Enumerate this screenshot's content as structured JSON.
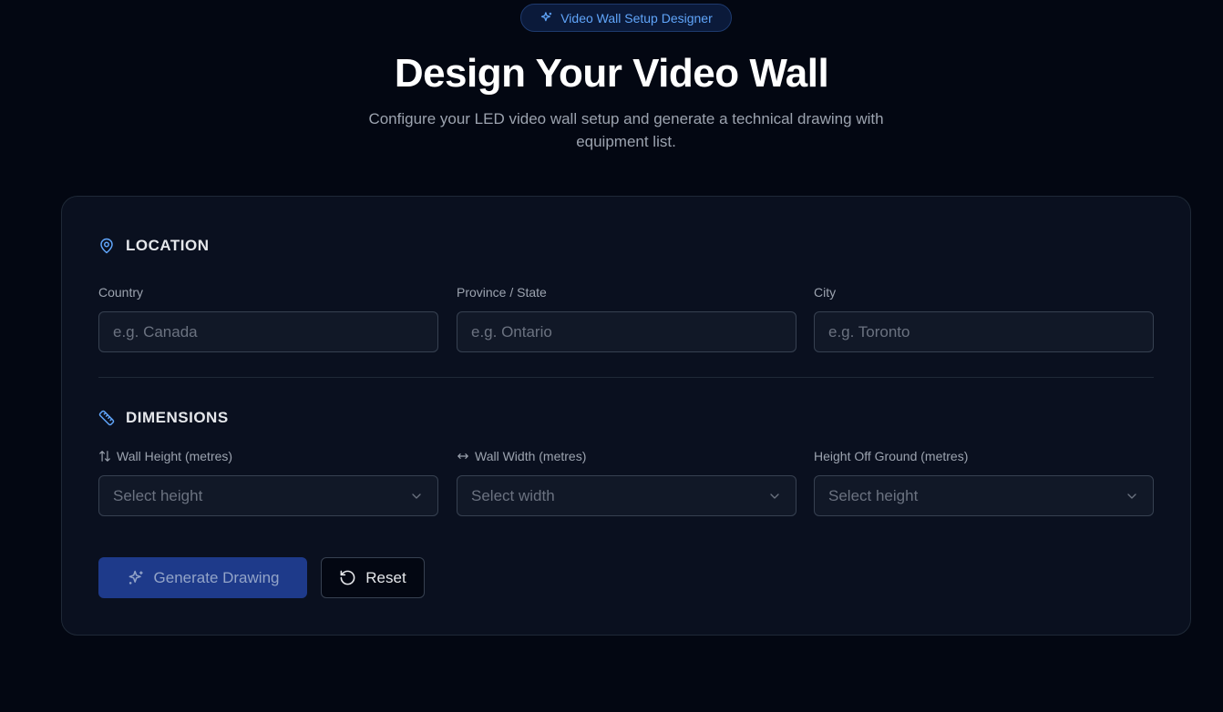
{
  "badge": {
    "label": "Video Wall Setup Designer",
    "icon": "sparkles-icon"
  },
  "header": {
    "title": "Design Your Video Wall",
    "subtitle": "Configure your LED video wall setup and generate a technical drawing with equipment list."
  },
  "location": {
    "heading": "LOCATION",
    "icon": "map-pin-icon",
    "fields": [
      {
        "label": "Country",
        "placeholder": "e.g. Canada",
        "value": ""
      },
      {
        "label": "Province / State",
        "placeholder": "e.g. Ontario",
        "value": ""
      },
      {
        "label": "City",
        "placeholder": "e.g. Toronto",
        "value": ""
      }
    ]
  },
  "dimensions": {
    "heading": "DIMENSIONS",
    "icon": "ruler-icon",
    "fields": [
      {
        "label": "Wall Height (metres)",
        "icon": "arrow-up-down-icon",
        "selected": "Select height"
      },
      {
        "label": "Wall Width (metres)",
        "icon": "arrow-left-right-icon",
        "selected": "Select width"
      },
      {
        "label": "Height Off Ground (metres)",
        "selected": "Select height"
      }
    ]
  },
  "actions": {
    "generate_label": "Generate Drawing",
    "reset_label": "Reset"
  },
  "colors": {
    "background": "#030712",
    "card": "#0a101f",
    "accent": "#60a5fa",
    "primary_button": "#1e3a8a"
  }
}
